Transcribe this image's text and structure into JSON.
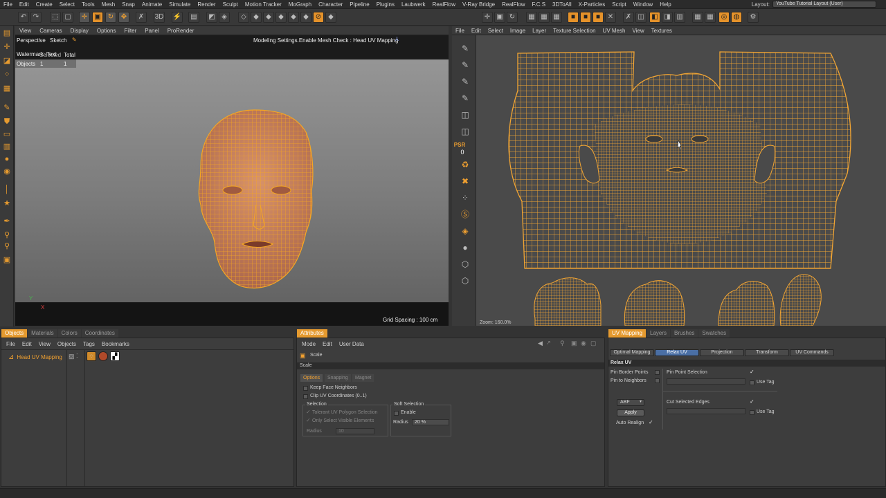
{
  "menu": [
    "File",
    "Edit",
    "Create",
    "Select",
    "Tools",
    "Mesh",
    "Snap",
    "Animate",
    "Simulate",
    "Render",
    "Sculpt",
    "Motion Tracker",
    "MoGraph",
    "Character",
    "Pipeline",
    "Plugins",
    "Laubwerk",
    "RealFlow",
    "V-Ray Bridge",
    "RealFlow",
    "F.C.S",
    "3DToAll",
    "X-Particles",
    "Script",
    "Window",
    "Help"
  ],
  "layout": {
    "label": "Layout:",
    "value": "YouTube Tutorial Layout (User)"
  },
  "viewport": {
    "menu": [
      "View",
      "Cameras",
      "Display",
      "Options",
      "Filter",
      "Panel",
      "ProRender"
    ],
    "camera": "Perspective",
    "sketch": "Sketch",
    "watermark": "Watermark",
    "selected": "Selected",
    "text": "Text",
    "total": "Total",
    "objects_label": "Objects",
    "objects_selected": "1",
    "objects_total": "1",
    "hud": "Modeling Settings.Enable Mesh Check : Head UV Mapping",
    "grid_spacing": "Grid Spacing : 100 cm",
    "axis_y": "Y",
    "axis_x": "X"
  },
  "uv": {
    "menu": [
      "File",
      "Edit",
      "Select",
      "Image",
      "Layer",
      "Texture Selection",
      "UV Mesh",
      "View",
      "Textures"
    ],
    "psr_label": "PSR",
    "psr_value": "0",
    "zoom": "Zoom: 160.0%"
  },
  "objects_panel": {
    "tabs": [
      "Objects",
      "Materials",
      "Colors",
      "Coordinates"
    ],
    "menu": [
      "File",
      "Edit",
      "View",
      "Objects",
      "Tags",
      "Bookmarks"
    ],
    "object_name": "Head UV Mapping"
  },
  "attributes_panel": {
    "tab": "Attributes",
    "menu": [
      "Mode",
      "Edit",
      "User Data"
    ],
    "tool_name": "Scale",
    "section": "Scale",
    "subtabs": [
      "Options",
      "Snapping",
      "Magnet"
    ],
    "keep_face_neighbors": "Keep Face Neighbors",
    "clip_uv": "Clip UV Coordinates (0..1)",
    "selection_group": "Selection",
    "tolerant": "Tolerant UV Polygon Selection",
    "only_visible": "Only Select Visible Elements",
    "radius_label": "Radius",
    "radius_value": "10",
    "soft_selection_group": "Soft Selection",
    "enable": "Enable",
    "soft_radius_label": "Radius",
    "soft_radius_value": "20 %"
  },
  "uv_mapping_panel": {
    "tabs": [
      "UV Mapping",
      "Layers",
      "Brushes",
      "Swatches"
    ],
    "subtabs": [
      "Optimal Mapping",
      "Relax UV",
      "Projection",
      "Transform",
      "UV Commands"
    ],
    "section": "Relax UV",
    "pin_border": "Pin Border Points",
    "pin_neighbors": "Pin to Neighbors",
    "pin_point_selection": "Pin Point Selection",
    "use_tag_1": "Use Tag",
    "method": "ABF",
    "apply": "Apply",
    "auto_realign": "Auto Realign",
    "cut_selected_edges": "Cut Selected Edges",
    "use_tag_2": "Use Tag"
  },
  "colors": {
    "accent": "#e59a2f",
    "mesh": "#f2a533"
  }
}
